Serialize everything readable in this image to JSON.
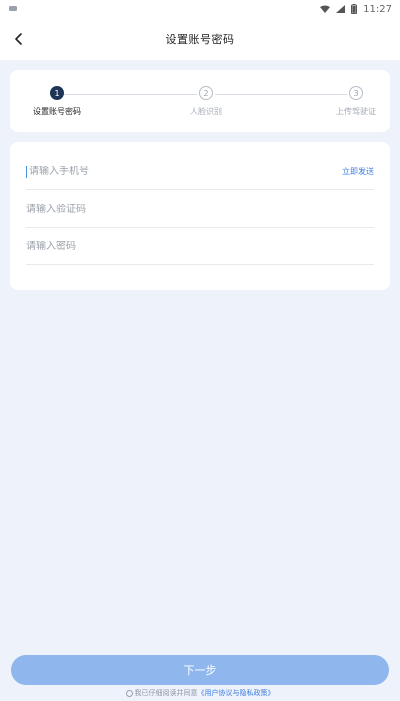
{
  "status_bar": {
    "time": "11:27",
    "icons": [
      "notification-icon",
      "wifi-icon",
      "signal-icon",
      "battery-icon"
    ]
  },
  "header": {
    "title": "设置账号密码",
    "back_icon": "chevron-left-icon"
  },
  "steps": [
    {
      "number": "1",
      "label": "设置账号密码",
      "active": true
    },
    {
      "number": "2",
      "label": "人脸识别",
      "active": false
    },
    {
      "number": "3",
      "label": "上传驾驶证",
      "active": false
    }
  ],
  "form": {
    "phone": {
      "value": "",
      "placeholder": "请输入手机号"
    },
    "send_code_label": "立即发送",
    "code": {
      "value": "",
      "placeholder": "请输入验证码"
    },
    "password": {
      "value": "",
      "placeholder": "请输入密码"
    }
  },
  "footer": {
    "next_label": "下一步",
    "agreement_prefix": "我已仔细阅读并同意",
    "agreement_link": "《用户协议与隐私政策》"
  },
  "colors": {
    "accent": "#3c7be0",
    "button": "#8fb7ee",
    "step_active": "#1e3558",
    "background": "#eef3fb"
  }
}
